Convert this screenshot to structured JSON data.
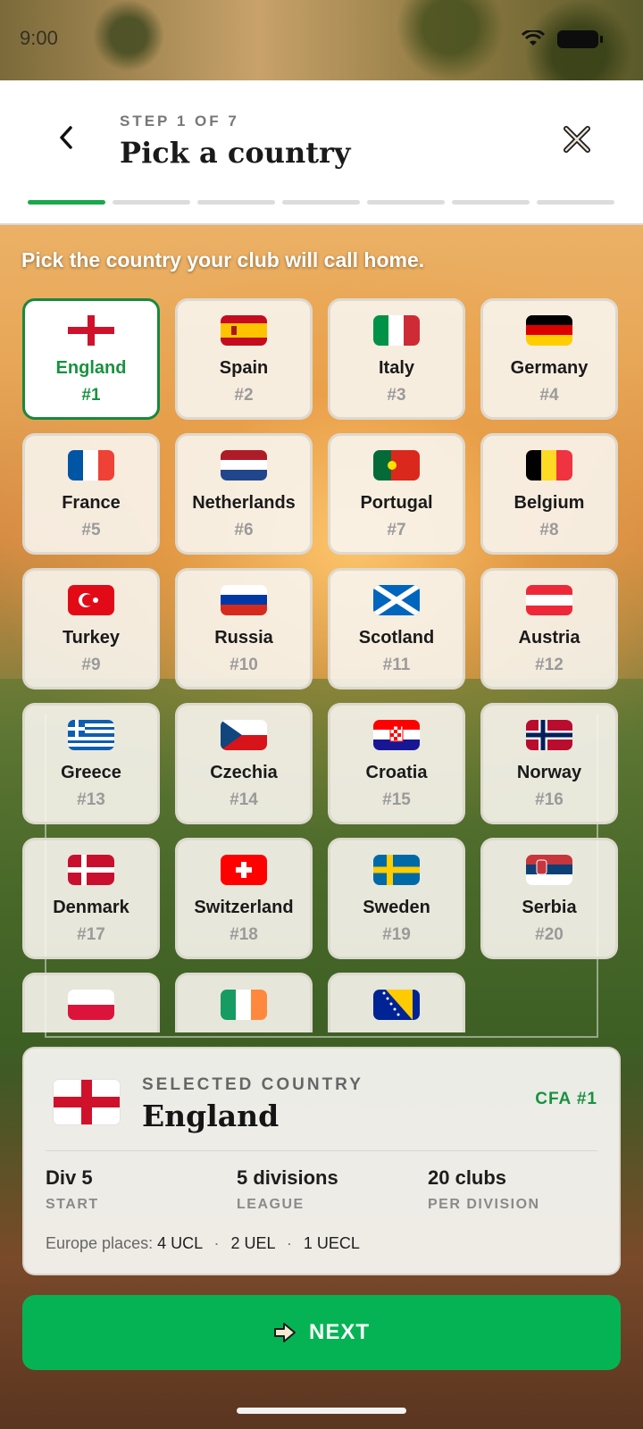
{
  "status": {
    "time": "9:00"
  },
  "header": {
    "step": "STEP 1 OF 7",
    "title": "Pick a country",
    "progress_total": 7,
    "progress_current": 1
  },
  "subtitle": "Pick the country your club will call home.",
  "countries": [
    {
      "name": "England",
      "rank": "#1",
      "flag": "england-flag-icon",
      "selected": true
    },
    {
      "name": "Spain",
      "rank": "#2",
      "flag": "spain-flag-icon"
    },
    {
      "name": "Italy",
      "rank": "#3",
      "flag": "italy-flag-icon"
    },
    {
      "name": "Germany",
      "rank": "#4",
      "flag": "germany-flag-icon"
    },
    {
      "name": "France",
      "rank": "#5",
      "flag": "france-flag-icon"
    },
    {
      "name": "Netherlands",
      "rank": "#6",
      "flag": "netherlands-flag-icon"
    },
    {
      "name": "Portugal",
      "rank": "#7",
      "flag": "portugal-flag-icon"
    },
    {
      "name": "Belgium",
      "rank": "#8",
      "flag": "belgium-flag-icon"
    },
    {
      "name": "Turkey",
      "rank": "#9",
      "flag": "turkey-flag-icon"
    },
    {
      "name": "Russia",
      "rank": "#10",
      "flag": "russia-flag-icon"
    },
    {
      "name": "Scotland",
      "rank": "#11",
      "flag": "scotland-flag-icon"
    },
    {
      "name": "Austria",
      "rank": "#12",
      "flag": "austria-flag-icon"
    },
    {
      "name": "Greece",
      "rank": "#13",
      "flag": "greece-flag-icon"
    },
    {
      "name": "Czechia",
      "rank": "#14",
      "flag": "czechia-flag-icon"
    },
    {
      "name": "Croatia",
      "rank": "#15",
      "flag": "croatia-flag-icon"
    },
    {
      "name": "Norway",
      "rank": "#16",
      "flag": "norway-flag-icon"
    },
    {
      "name": "Denmark",
      "rank": "#17",
      "flag": "denmark-flag-icon"
    },
    {
      "name": "Switzerland",
      "rank": "#18",
      "flag": "switzerland-flag-icon"
    },
    {
      "name": "Sweden",
      "rank": "#19",
      "flag": "sweden-flag-icon"
    },
    {
      "name": "Serbia",
      "rank": "#20",
      "flag": "serbia-flag-icon"
    },
    {
      "name": "",
      "rank": "",
      "flag": "poland-flag-icon"
    },
    {
      "name": "",
      "rank": "",
      "flag": "ireland-flag-icon"
    },
    {
      "name": "",
      "rank": "",
      "flag": "bosnia-flag-icon"
    }
  ],
  "selected": {
    "label": "SELECTED COUNTRY",
    "name": "England",
    "badge": "CFA #1",
    "flag": "england-flag-icon",
    "stats": [
      {
        "value": "Div 5",
        "label": "START"
      },
      {
        "value": "5 divisions",
        "label": "LEAGUE"
      },
      {
        "value": "20 clubs",
        "label": "PER DIVISION"
      }
    ],
    "europe": {
      "prefix": "Europe places:",
      "places": [
        "4 UCL",
        "2 UEL",
        "1 UECL"
      ],
      "separator": "·"
    }
  },
  "next_button": {
    "label": "NEXT",
    "icon": "arrow-right-icon"
  },
  "colors": {
    "accent": "#19a84c",
    "button": "#06b354",
    "selected_text": "#18923f"
  }
}
